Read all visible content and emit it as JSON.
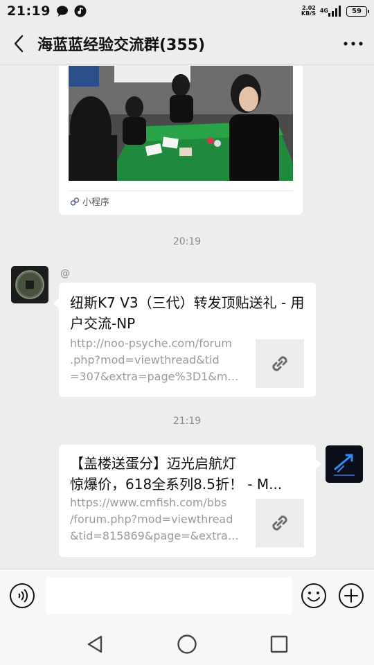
{
  "status": {
    "time": "21:19",
    "net_speed_value": "2.02",
    "net_speed_unit": "KB/S",
    "network_type": "4G",
    "battery": "59"
  },
  "header": {
    "title": "海蓝蓝经验交流群(355)"
  },
  "messages": [
    {
      "type": "mini_program",
      "footer_label": "小程序"
    },
    {
      "type": "timestamp",
      "text": "20:19"
    },
    {
      "type": "link",
      "side": "left",
      "mention": "@",
      "title": "纽斯K7 V3（三代）转发顶贴送礼 - 用户交流-NP",
      "url_lines": [
        "http://noo-psyche.com/forum",
        ".php?mod=viewthread&tid",
        "=307&extra=page%3D1&mo..."
      ]
    },
    {
      "type": "timestamp",
      "text": "21:19"
    },
    {
      "type": "link",
      "side": "right",
      "title_lines": [
        "【盖楼送蛋分】迈光启航灯",
        "惊爆价，618全系列8.5折！ - M..."
      ],
      "url_lines": [
        "https://www.cmfish.com/bbs",
        "/forum.php?mod=viewthread",
        "&tid=815869&page=&extra=..."
      ]
    }
  ],
  "input": {
    "placeholder": ""
  },
  "icons": {
    "back": "back-arrow-icon",
    "more": "more-dots-icon",
    "voice": "voice-icon",
    "emoji": "emoji-icon",
    "add": "plus-icon",
    "link": "link-icon",
    "mini_program": "mini-program-icon",
    "nav_back": "triangle-back-icon",
    "nav_home": "circle-home-icon",
    "nav_recent": "square-recent-icon"
  }
}
